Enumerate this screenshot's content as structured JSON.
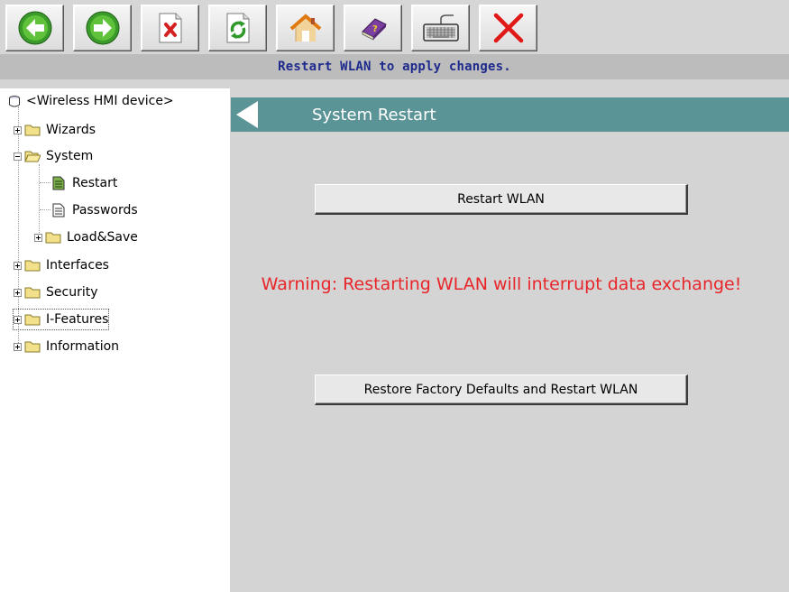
{
  "toolbar": {
    "buttons": [
      {
        "icon": "back-arrow-icon"
      },
      {
        "icon": "forward-arrow-icon"
      },
      {
        "icon": "stop-icon"
      },
      {
        "icon": "refresh-icon"
      },
      {
        "icon": "home-icon"
      },
      {
        "icon": "help-book-icon"
      },
      {
        "icon": "keyboard-icon"
      },
      {
        "icon": "close-x-icon"
      }
    ]
  },
  "status": {
    "message": "Restart WLAN to apply changes.",
    "color": "#1e2a8c"
  },
  "tree": {
    "root": "<Wireless HMI device>",
    "items": [
      {
        "label": "Wizards",
        "expanded": false
      },
      {
        "label": "System",
        "expanded": true
      },
      {
        "label": "Restart",
        "selected": true
      },
      {
        "label": "Passwords"
      },
      {
        "label": "Load&Save",
        "expanded": false
      },
      {
        "label": "Interfaces",
        "expanded": false
      },
      {
        "label": "Security",
        "expanded": false
      },
      {
        "label": "I-Features",
        "expanded": false
      },
      {
        "label": "Information",
        "expanded": false
      }
    ]
  },
  "content": {
    "title": "System Restart",
    "header_color": "#5b9496",
    "restart_button": "Restart WLAN",
    "warning": "Warning: Restarting WLAN will interrupt data exchange!",
    "warning_color": "#e8262a",
    "factory_button": "Restore Factory Defaults and Restart WLAN"
  }
}
